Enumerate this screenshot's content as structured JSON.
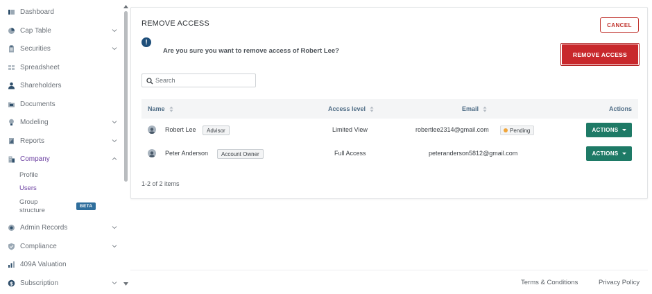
{
  "sidebar": {
    "items": [
      {
        "label": "Dashboard",
        "icon": "dashboard-icon",
        "chevron": false
      },
      {
        "label": "Cap Table",
        "icon": "pie-chart-icon",
        "chevron": true
      },
      {
        "label": "Securities",
        "icon": "clipboard-icon",
        "chevron": true
      },
      {
        "label": "Spreadsheet",
        "icon": "spreadsheet-icon",
        "chevron": false
      },
      {
        "label": "Shareholders",
        "icon": "person-icon",
        "chevron": false
      },
      {
        "label": "Documents",
        "icon": "folder-icon",
        "chevron": false
      },
      {
        "label": "Modeling",
        "icon": "lightbulb-icon",
        "chevron": true
      },
      {
        "label": "Reports",
        "icon": "reports-icon",
        "chevron": true
      },
      {
        "label": "Company",
        "icon": "building-icon",
        "chevron": true,
        "expanded": true
      },
      {
        "label": "Admin Records",
        "icon": "records-icon",
        "chevron": true
      },
      {
        "label": "Compliance",
        "icon": "shield-icon",
        "chevron": true
      },
      {
        "label": "409A Valuation",
        "icon": "valuation-icon",
        "chevron": false
      },
      {
        "label": "Subscription",
        "icon": "dollar-icon",
        "chevron": true
      }
    ],
    "company_sub": {
      "profile": "Profile",
      "users": "Users",
      "group_line1": "Group",
      "group_line2": "structure",
      "beta": "BETA"
    }
  },
  "panel": {
    "title": "REMOVE ACCESS",
    "cancel_label": "CANCEL",
    "confirm_text": "Are you sure you want to remove access of Robert Lee?",
    "remove_label": "REMOVE ACCESS",
    "info_glyph": "!"
  },
  "search": {
    "placeholder": "Search"
  },
  "table": {
    "headers": {
      "name": "Name",
      "access": "Access level",
      "email": "Email",
      "actions": "Actions"
    },
    "rows": [
      {
        "name": "Robert Lee",
        "role": "Advisor",
        "access": "Limited View",
        "email": "robertlee2314@gmail.com",
        "status": "Pending",
        "action": "ACTIONS"
      },
      {
        "name": "Peter Anderson",
        "role": "Account Owner",
        "access": "Full Access",
        "email": "peteranderson5812@gmail.com",
        "status": "",
        "action": "ACTIONS"
      }
    ],
    "pager": "1-2 of 2 items"
  },
  "footer": {
    "terms": "Terms & Conditions",
    "privacy": "Privacy Policy"
  },
  "colors": {
    "accent_purple": "#6b3fa0",
    "danger": "#c8282c",
    "action_green": "#1e7a66",
    "pending_dot": "#f0a53a"
  }
}
